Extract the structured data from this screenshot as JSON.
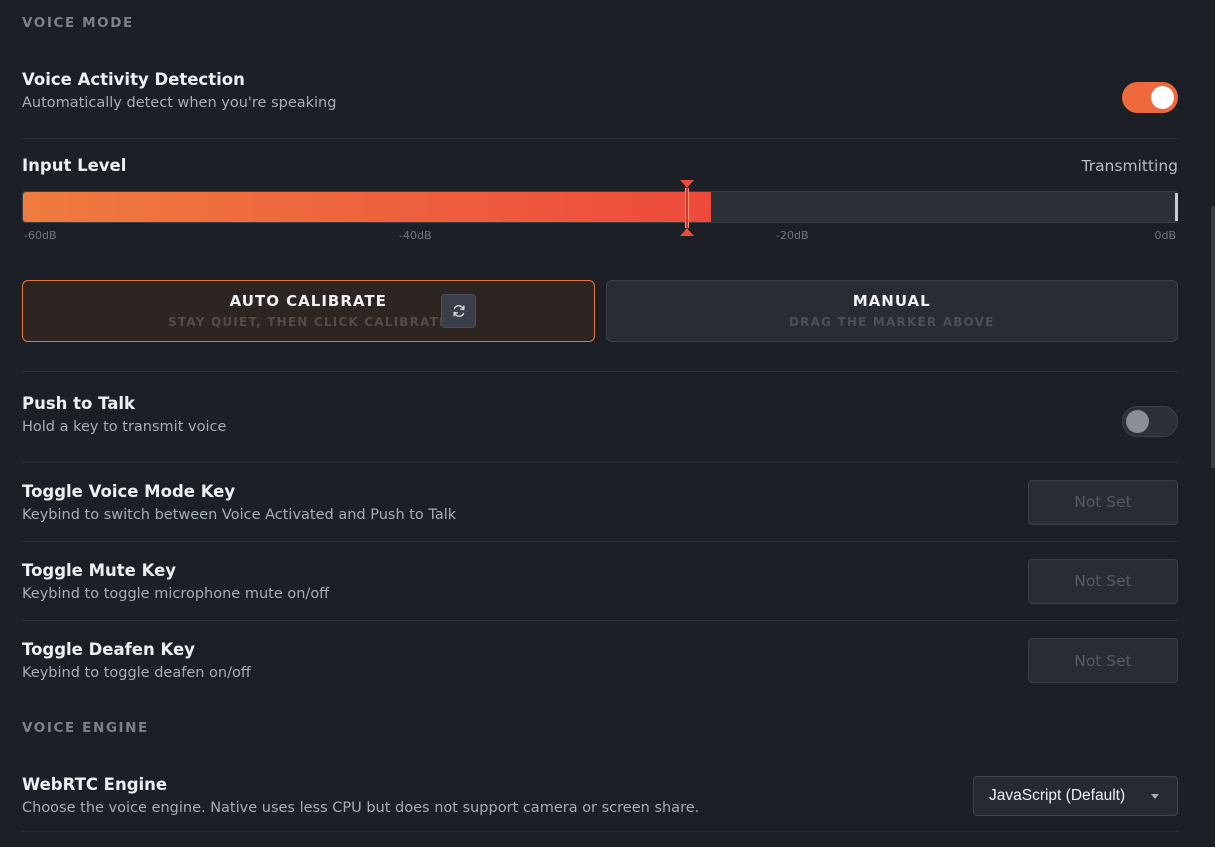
{
  "voice_mode": {
    "section_title": "VOICE MODE",
    "vad": {
      "title": "Voice Activity Detection",
      "description": "Automatically detect when you're speaking",
      "enabled": true
    },
    "input_level": {
      "title": "Input Level",
      "status": "Transmitting",
      "level_fraction": 0.596,
      "threshold_fraction": 0.575,
      "ticks": [
        "-60dB",
        "-40dB",
        "-20dB",
        "0dB"
      ]
    },
    "calibration": {
      "auto": {
        "title": "AUTO CALIBRATE",
        "subtitle": "STAY QUIET, THEN CLICK CALIBRATE",
        "selected": true
      },
      "manual": {
        "title": "MANUAL",
        "subtitle": "DRAG THE MARKER ABOVE",
        "selected": false
      }
    },
    "ptt": {
      "title": "Push to Talk",
      "description": "Hold a key to transmit voice",
      "enabled": false
    },
    "keybinds": [
      {
        "title": "Toggle Voice Mode Key",
        "description": "Keybind to switch between Voice Activated and Push to Talk",
        "value": "Not Set"
      },
      {
        "title": "Toggle Mute Key",
        "description": "Keybind to toggle microphone mute on/off",
        "value": "Not Set"
      },
      {
        "title": "Toggle Deafen Key",
        "description": "Keybind to toggle deafen on/off",
        "value": "Not Set"
      }
    ]
  },
  "voice_engine": {
    "section_title": "VOICE ENGINE",
    "webrtc": {
      "title": "WebRTC Engine",
      "description": "Choose the voice engine. Native uses less CPU but does not support camera or screen share.",
      "selected": "JavaScript (Default)"
    }
  },
  "colors": {
    "accent": "#ee6a3c",
    "background": "#1c1f25"
  }
}
